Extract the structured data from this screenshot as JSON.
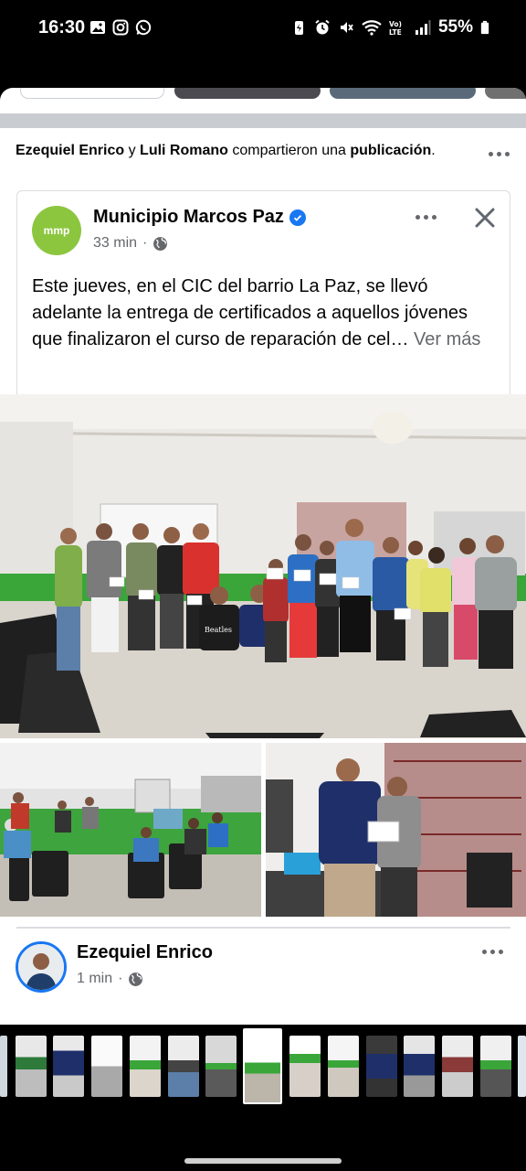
{
  "status_bar": {
    "time": "16:30",
    "battery": "55%",
    "left_icons": [
      "gallery-icon",
      "instagram-icon",
      "whatsapp-icon"
    ],
    "right_icons": [
      "battery-saver-icon",
      "alarm-icon",
      "mute-icon",
      "wifi-icon",
      "volte-icon",
      "signal-icon",
      "battery-icon"
    ]
  },
  "share_header": {
    "user1": "Ezequiel Enrico",
    "connector": "y",
    "user2": "Luli Romano",
    "action_text": "compartieron una",
    "object": "publicación",
    "period": "."
  },
  "post": {
    "page_name": "Municipio Marcos Paz",
    "logo_text": "mmp",
    "time": "33 min",
    "separator": "·",
    "body": "Este jueves, en el CIC del barrio La Paz, se llevó adelante la entrega de certificados a aquellos jóvenes que finalizaron el curso de reparación de cel…",
    "see_more": "Ver más",
    "shirt_text": "Beatles"
  },
  "sharer": {
    "name": "Ezequiel Enrico",
    "time": "1 min",
    "separator": "·"
  },
  "colors": {
    "brand_blue": "#1877f2",
    "logo_green": "#8cc63f",
    "wall_green": "#3aa63a",
    "text_secondary": "#65676b"
  }
}
